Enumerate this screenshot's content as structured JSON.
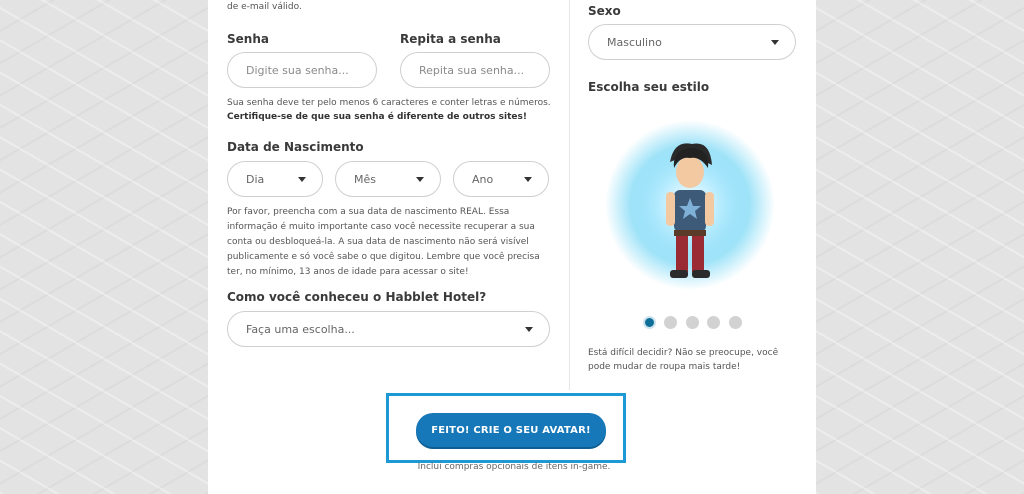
{
  "form": {
    "email_hint_tail": "de e-mail válido.",
    "password_label": "Senha",
    "password_placeholder": "Digite sua senha...",
    "password_repeat_label": "Repita a senha",
    "password_repeat_placeholder": "Repita sua senha...",
    "password_hint": "Sua senha deve ter pelo menos 6 caracteres e conter letras e números.",
    "password_hint_bold": "Certifique-se de que sua senha é diferente de outros sites!",
    "birthdate_label": "Data de Nascimento",
    "day": "Dia",
    "month": "Mês",
    "year": "Ano",
    "birthdate_hint_lines": [
      "Por favor, preencha com a sua data de nascimento REAL. Essa",
      "informação é muito importante caso você necessite recuperar a sua",
      "conta ou desbloqueá-la. A sua data de nascimento não será visível",
      "publicamente e só você sabe o que digitou. Lembre que você precisa",
      "ter, no mínimo, 13 anos de idade para acessar o site!"
    ],
    "source_label": "Como você conheceu o Habblet Hotel?",
    "source_value": "Faça uma escolha...",
    "gender_label": "Sexo",
    "gender_value": "Masculino",
    "style_label": "Escolha seu estilo",
    "style_hint_line1": "Está difícil decidir? Não se preocupe, você",
    "style_hint_line2": "pode mudar de roupa mais tarde!",
    "cta_label": "FEITO! CRIE O SEU AVATAR!",
    "cta_note": "Inclui compras opcionais de itens in-game."
  },
  "carousel": {
    "count": 5,
    "active_index": 0
  },
  "colors": {
    "accent": "#1678b8",
    "highlight": "#1d9ad6",
    "active_dot": "#0f6f98"
  }
}
